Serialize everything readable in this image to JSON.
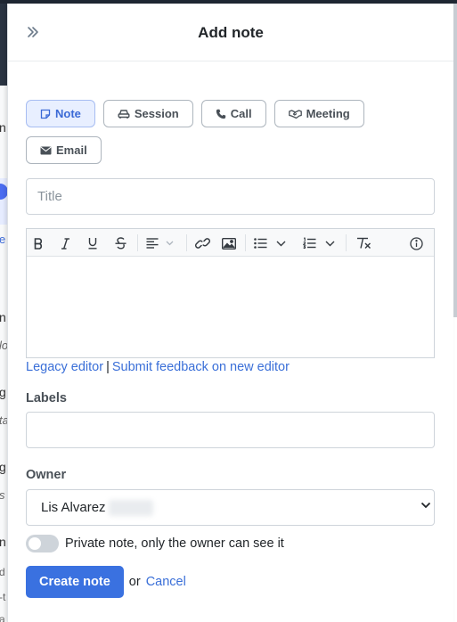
{
  "header": {
    "title": "Add note"
  },
  "tabs": [
    {
      "label": "Note",
      "icon": "note-icon",
      "active": true
    },
    {
      "label": "Session",
      "icon": "car-icon",
      "active": false
    },
    {
      "label": "Call",
      "icon": "phone-icon",
      "active": false
    },
    {
      "label": "Meeting",
      "icon": "handshake-icon",
      "active": false
    },
    {
      "label": "Email",
      "icon": "envelope-icon",
      "active": false
    }
  ],
  "title_field": {
    "placeholder": "Title",
    "value": ""
  },
  "editor": {
    "toolbar": [
      "bold-icon",
      "italic-icon",
      "underline-icon",
      "strikethrough-icon",
      "align-icon",
      "link-icon",
      "image-icon",
      "bullet-list-icon",
      "numbered-list-icon",
      "clear-format-icon",
      "info-icon"
    ],
    "legacy_link": "Legacy editor",
    "separator": "|",
    "feedback_link": "Submit feedback on new editor"
  },
  "labels_field": {
    "label": "Labels",
    "value": ""
  },
  "owner_field": {
    "label": "Owner",
    "value": "Lis Alvarez"
  },
  "private_toggle": {
    "label": "Private note, only the owner can see it",
    "checked": false
  },
  "actions": {
    "submit": "Create note",
    "or": "or",
    "cancel": "Cancel"
  },
  "background": {
    "fragments": [
      "n",
      "e",
      "n",
      "lo",
      "g",
      "ta",
      "g",
      "s",
      "n",
      "d",
      "-t",
      "a"
    ]
  },
  "colors": {
    "accent": "#3a71e0",
    "link": "#3a6fd8",
    "active_tab_bg": "#e8efff"
  }
}
